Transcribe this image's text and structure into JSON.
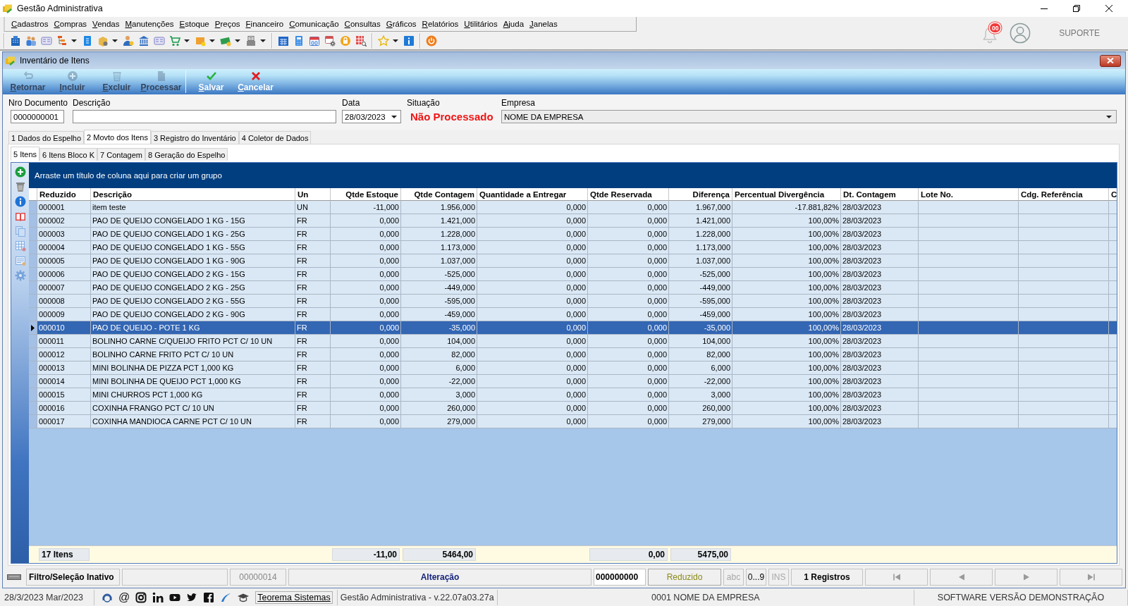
{
  "window": {
    "title": "Gestão Administrativa"
  },
  "menu": [
    "Cadastros",
    "Compras",
    "Vendas",
    "Manutenções",
    "Estoque",
    "Preços",
    "Financeiro",
    "Comunicação",
    "Consultas",
    "Gráficos",
    "Relatórios",
    "Utilitários",
    "Ajuda",
    "Janelas"
  ],
  "account": {
    "notifications": "00",
    "support": "SUPORTE"
  },
  "form_window": {
    "title": "Inventário de Itens"
  },
  "toolbar": [
    {
      "label": "Retornar",
      "disabled": true
    },
    {
      "label": "Incluir",
      "disabled": true
    },
    {
      "label": "Excluir",
      "disabled": true
    },
    {
      "label": "Processar",
      "disabled": true
    },
    {
      "label": "Salvar",
      "disabled": false
    },
    {
      "label": "Cancelar",
      "disabled": false
    }
  ],
  "fields": [
    {
      "label": "Nro Documento",
      "kind": "text",
      "value": "0000000001"
    },
    {
      "label": "Descrição",
      "kind": "text"
    },
    {
      "label": "Data",
      "kind": "date",
      "value": "28/03/2023"
    },
    {
      "label": "Situação",
      "kind": "status",
      "value": "Não Processado"
    },
    {
      "label": "Empresa",
      "kind": "select",
      "value": "NOME DA EMPRESA"
    }
  ],
  "tabs": [
    {
      "label": "1 Dados do Espelho",
      "selected": false
    },
    {
      "label": "2 Movto dos Itens",
      "selected": true
    },
    {
      "label": "3 Registro do Inventário",
      "selected": false
    },
    {
      "label": "4 Coletor de Dados",
      "selected": false
    }
  ],
  "subtabs": [
    {
      "label": "5 Itens",
      "selected": true
    },
    {
      "label": "6 Itens Bloco K",
      "selected": false
    },
    {
      "label": "7 Contagem",
      "selected": false
    },
    {
      "label": "8 Geração do Espelho",
      "selected": false
    }
  ],
  "grid": {
    "group_hint": "Arraste um título de coluna aqui para criar um grupo",
    "columns": [
      {
        "label": "Reduzido",
        "kind": "text",
        "total": "17 Itens"
      },
      {
        "label": "Descrição",
        "kind": "text"
      },
      {
        "label": "Un",
        "kind": "text"
      },
      {
        "label": "Qtde Estoque",
        "kind": "number",
        "total": "-11,00"
      },
      {
        "label": "Qtde Contagem",
        "kind": "number",
        "total": "5464,00"
      },
      {
        "label": "Quantidade a Entregar",
        "kind": "number"
      },
      {
        "label": "Qtde Reservada",
        "kind": "number",
        "total": "0,00"
      },
      {
        "label": "Diferença",
        "kind": "number",
        "total": "5475,00"
      },
      {
        "label": "Percentual Divergência",
        "kind": "number"
      },
      {
        "label": "Dt. Contagem",
        "kind": "text"
      },
      {
        "label": "Lote No.",
        "kind": "text"
      },
      {
        "label": "Cdg. Referência",
        "kind": "text"
      },
      {
        "label": "C",
        "kind": "text"
      }
    ],
    "rows": [
      {
        "cells": [
          "000001",
          "item teste",
          "UN",
          "-11,000",
          "1.956,000",
          "0,000",
          "0,000",
          "1.967,000",
          "-17.881,82%",
          "28/03/2023"
        ],
        "selected": false
      },
      {
        "cells": [
          "000002",
          "PAO DE QUEIJO CONGELADO 1 KG - 15G",
          "FR",
          "0,000",
          "1.421,000",
          "0,000",
          "0,000",
          "1.421,000",
          "100,00%",
          "28/03/2023"
        ],
        "selected": false
      },
      {
        "cells": [
          "000003",
          "PAO DE QUEIJO CONGELADO 1 KG - 25G",
          "FR",
          "0,000",
          "1.228,000",
          "0,000",
          "0,000",
          "1.228,000",
          "100,00%",
          "28/03/2023"
        ],
        "selected": false
      },
      {
        "cells": [
          "000004",
          "PAO DE QUEIJO CONGELADO 1 KG - 55G",
          "FR",
          "0,000",
          "1.173,000",
          "0,000",
          "0,000",
          "1.173,000",
          "100,00%",
          "28/03/2023"
        ],
        "selected": false
      },
      {
        "cells": [
          "000005",
          "PAO DE QUEIJO CONGELADO 1 KG - 90G",
          "FR",
          "0,000",
          "1.037,000",
          "0,000",
          "0,000",
          "1.037,000",
          "100,00%",
          "28/03/2023"
        ],
        "selected": false
      },
      {
        "cells": [
          "000006",
          "PAO DE QUEIJO CONGELADO 2 KG - 15G",
          "FR",
          "0,000",
          "-525,000",
          "0,000",
          "0,000",
          "-525,000",
          "100,00%",
          "28/03/2023"
        ],
        "selected": false
      },
      {
        "cells": [
          "000007",
          "PAO DE QUEIJO CONGELADO 2 KG - 25G",
          "FR",
          "0,000",
          "-449,000",
          "0,000",
          "0,000",
          "-449,000",
          "100,00%",
          "28/03/2023"
        ],
        "selected": false
      },
      {
        "cells": [
          "000008",
          "PAO DE QUEIJO CONGELADO 2 KG - 55G",
          "FR",
          "0,000",
          "-595,000",
          "0,000",
          "0,000",
          "-595,000",
          "100,00%",
          "28/03/2023"
        ],
        "selected": false
      },
      {
        "cells": [
          "000009",
          "PAO DE QUEIJO CONGELADO 2 KG - 90G",
          "FR",
          "0,000",
          "-459,000",
          "0,000",
          "0,000",
          "-459,000",
          "100,00%",
          "28/03/2023"
        ],
        "selected": false
      },
      {
        "cells": [
          "000010",
          "PAO DE QUEIJO - POTE 1 KG",
          "FR",
          "0,000",
          "-35,000",
          "0,000",
          "0,000",
          "-35,000",
          "100,00%",
          "28/03/2023"
        ],
        "selected": true
      },
      {
        "cells": [
          "000011",
          "BOLINHO CARNE C/QUEIJO FRITO PCT C/ 10 UN",
          "FR",
          "0,000",
          "104,000",
          "0,000",
          "0,000",
          "104,000",
          "100,00%",
          "28/03/2023"
        ],
        "selected": false
      },
      {
        "cells": [
          "000012",
          "BOLINHO CARNE FRITO PCT C/ 10 UN",
          "FR",
          "0,000",
          "82,000",
          "0,000",
          "0,000",
          "82,000",
          "100,00%",
          "28/03/2023"
        ],
        "selected": false
      },
      {
        "cells": [
          "000013",
          "MINI BOLINHA DE PIZZA PCT 1,000 KG",
          "FR",
          "0,000",
          "6,000",
          "0,000",
          "0,000",
          "6,000",
          "100,00%",
          "28/03/2023"
        ],
        "selected": false
      },
      {
        "cells": [
          "000014",
          "MINI BOLINHA DE QUEIJO PCT 1,000 KG",
          "FR",
          "0,000",
          "-22,000",
          "0,000",
          "0,000",
          "-22,000",
          "100,00%",
          "28/03/2023"
        ],
        "selected": false
      },
      {
        "cells": [
          "000015",
          "MINI CHURROS PCT 1,000 KG",
          "FR",
          "0,000",
          "3,000",
          "0,000",
          "0,000",
          "3,000",
          "100,00%",
          "28/03/2023"
        ],
        "selected": false
      },
      {
        "cells": [
          "000016",
          "COXINHA FRANGO PCT C/ 10 UN",
          "FR",
          "0,000",
          "260,000",
          "0,000",
          "0,000",
          "260,000",
          "100,00%",
          "28/03/2023"
        ],
        "selected": false
      },
      {
        "cells": [
          "000017",
          "COXINHA MANDIOCA CARNE PCT C/ 10 UN",
          "FR",
          "0,000",
          "279,000",
          "0,000",
          "0,000",
          "279,000",
          "100,00%",
          "28/03/2023"
        ],
        "selected": false
      }
    ]
  },
  "status_bar": {
    "filter": "Filtro/Seleção Inativo",
    "code": "00000014",
    "mode": "Alteração",
    "search_value": "000000000",
    "search_field": "Reduzido",
    "indicators": [
      {
        "label": "abc",
        "active": false
      },
      {
        "label": "0...9",
        "active": true
      },
      {
        "label": "INS",
        "active": false
      }
    ],
    "records": "1 Registros"
  },
  "footer": {
    "date": "28/3/2023 Mar/2023",
    "at_sign": "@",
    "link": "Teorema Sistemas",
    "version": "Gestão Administrativa - v.22.07a03.27a",
    "company": "0001 NOME DA EMPRESA",
    "license": "SOFTWARE VERSÃO DEMONSTRAÇÃO"
  }
}
